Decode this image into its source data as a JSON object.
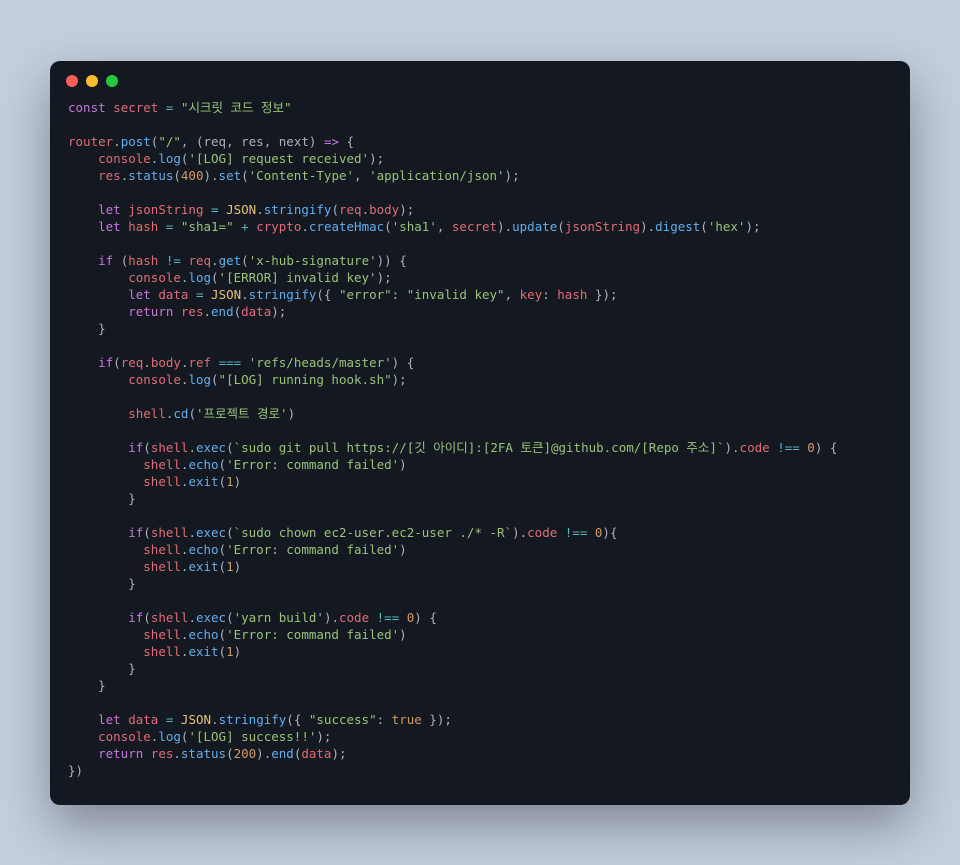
{
  "code": {
    "secret_const": "const",
    "secret_name": "secret",
    "secret_value": "\"시크릿 코드 정보\"",
    "router": "router",
    "post": "post",
    "route": "\"/\"",
    "req": "req",
    "res": "res",
    "next": "next",
    "console": "console",
    "log": "log",
    "log_request": "'[LOG] request received'",
    "status": "status",
    "status_400": "400",
    "set": "set",
    "content_type": "'Content-Type'",
    "app_json": "'application/json'",
    "let": "let",
    "jsonString": "jsonString",
    "JSON": "JSON",
    "stringify": "stringify",
    "body": "body",
    "hash": "hash",
    "sha1_prefix": "\"sha1=\"",
    "crypto": "crypto",
    "createHmac": "createHmac",
    "sha1": "'sha1'",
    "update": "update",
    "digest": "digest",
    "hex": "'hex'",
    "if": "if",
    "get": "get",
    "x_hub": "'x-hub-signature'",
    "log_error": "'[ERROR] invalid key'",
    "data": "data",
    "error_key": "\"error\"",
    "invalid_key": "\"invalid key\"",
    "key": "key",
    "return": "return",
    "end": "end",
    "ref": "ref",
    "refs_master": "'refs/heads/master'",
    "log_hook": "\"[LOG] running hook.sh\"",
    "shell": "shell",
    "cd": "cd",
    "project_path": "'프로젝트 경로'",
    "exec": "exec",
    "git_pull": "`sudo git pull https://[깃 아이디]:[2FA 토큰]@github.com/[Repo 주소]`",
    "code_prop": "code",
    "zero": "0",
    "echo": "echo",
    "cmd_failed": "'Error: command failed'",
    "exit": "exit",
    "one": "1",
    "chown": "`sudo chown ec2-user.ec2-user ./* -R`",
    "yarn_build": "'yarn build'",
    "success_key": "\"success\"",
    "true": "true",
    "log_success": "'[LOG] success!!'",
    "status_200": "200"
  }
}
